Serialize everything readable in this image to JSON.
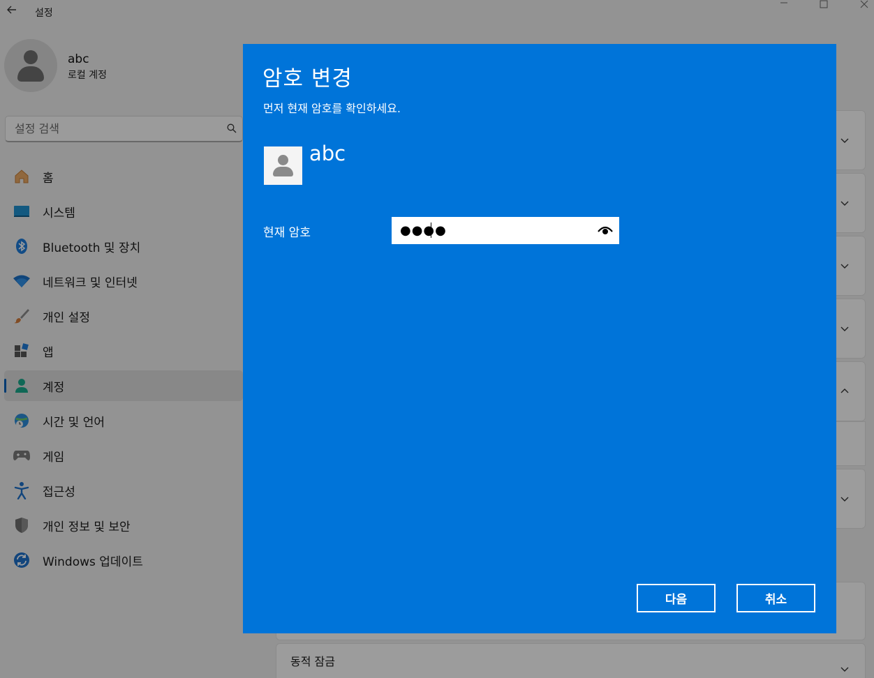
{
  "window": {
    "title": "설정"
  },
  "profile": {
    "name": "abc",
    "account_type": "로컬 계정"
  },
  "search": {
    "placeholder": "설정 검색"
  },
  "sidebar": {
    "items": [
      {
        "label": "홈",
        "icon": "home-icon"
      },
      {
        "label": "시스템",
        "icon": "system-icon"
      },
      {
        "label": "Bluetooth 및 장치",
        "icon": "bluetooth-icon"
      },
      {
        "label": "네트워크 및 인터넷",
        "icon": "wifi-icon"
      },
      {
        "label": "개인 설정",
        "icon": "brush-icon"
      },
      {
        "label": "앱",
        "icon": "apps-icon"
      },
      {
        "label": "계정",
        "icon": "accounts-icon",
        "active": true
      },
      {
        "label": "시간 및 언어",
        "icon": "globe-clock-icon"
      },
      {
        "label": "게임",
        "icon": "gamepad-icon"
      },
      {
        "label": "접근성",
        "icon": "accessibility-icon"
      },
      {
        "label": "개인 정보 및 보안",
        "icon": "shield-icon"
      },
      {
        "label": "Windows 업데이트",
        "icon": "update-icon"
      }
    ]
  },
  "main": {
    "bottom_card_label": "동적 잠금"
  },
  "dialog": {
    "title": "암호 변경",
    "subtitle": "먼저 현재 암호를 확인하세요.",
    "username": "abc",
    "password_label": "현재 암호",
    "password_value": "●●●●",
    "next_label": "다음",
    "cancel_label": "취소"
  },
  "colors": {
    "dialog_bg": "#0074d9",
    "accent": "#005fb8"
  }
}
